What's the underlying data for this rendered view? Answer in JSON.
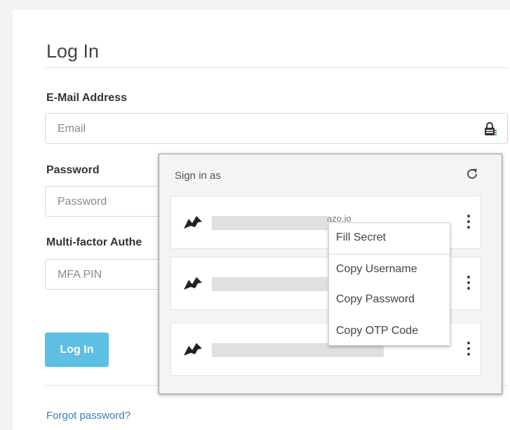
{
  "login": {
    "title": "Log In",
    "email_label": "E-Mail Address",
    "email_placeholder": "Email",
    "password_label": "Password",
    "password_placeholder": "Password",
    "mfa_label": "Multi-factor Authe",
    "mfa_placeholder": "MFA PIN",
    "login_button": "Log In",
    "forgot_link": "Forgot password?"
  },
  "popup": {
    "heading": "Sign in as",
    "entries": [
      {
        "tail": "azo.io"
      },
      {
        "tail": ""
      },
      {
        "tail": ""
      }
    ]
  },
  "context_menu": {
    "items": [
      "Fill Secret",
      "Copy Username",
      "Copy Password",
      "Copy OTP Code"
    ]
  },
  "icons": {
    "lock": "lock-icon",
    "refresh": "refresh-icon",
    "keeper_logo": "keeper-logo-icon",
    "kebab": "more-vertical-icon"
  },
  "colors": {
    "primary_button": "#5dbfe3",
    "link": "#3a7abf",
    "lock_accent": "#4caf50"
  }
}
